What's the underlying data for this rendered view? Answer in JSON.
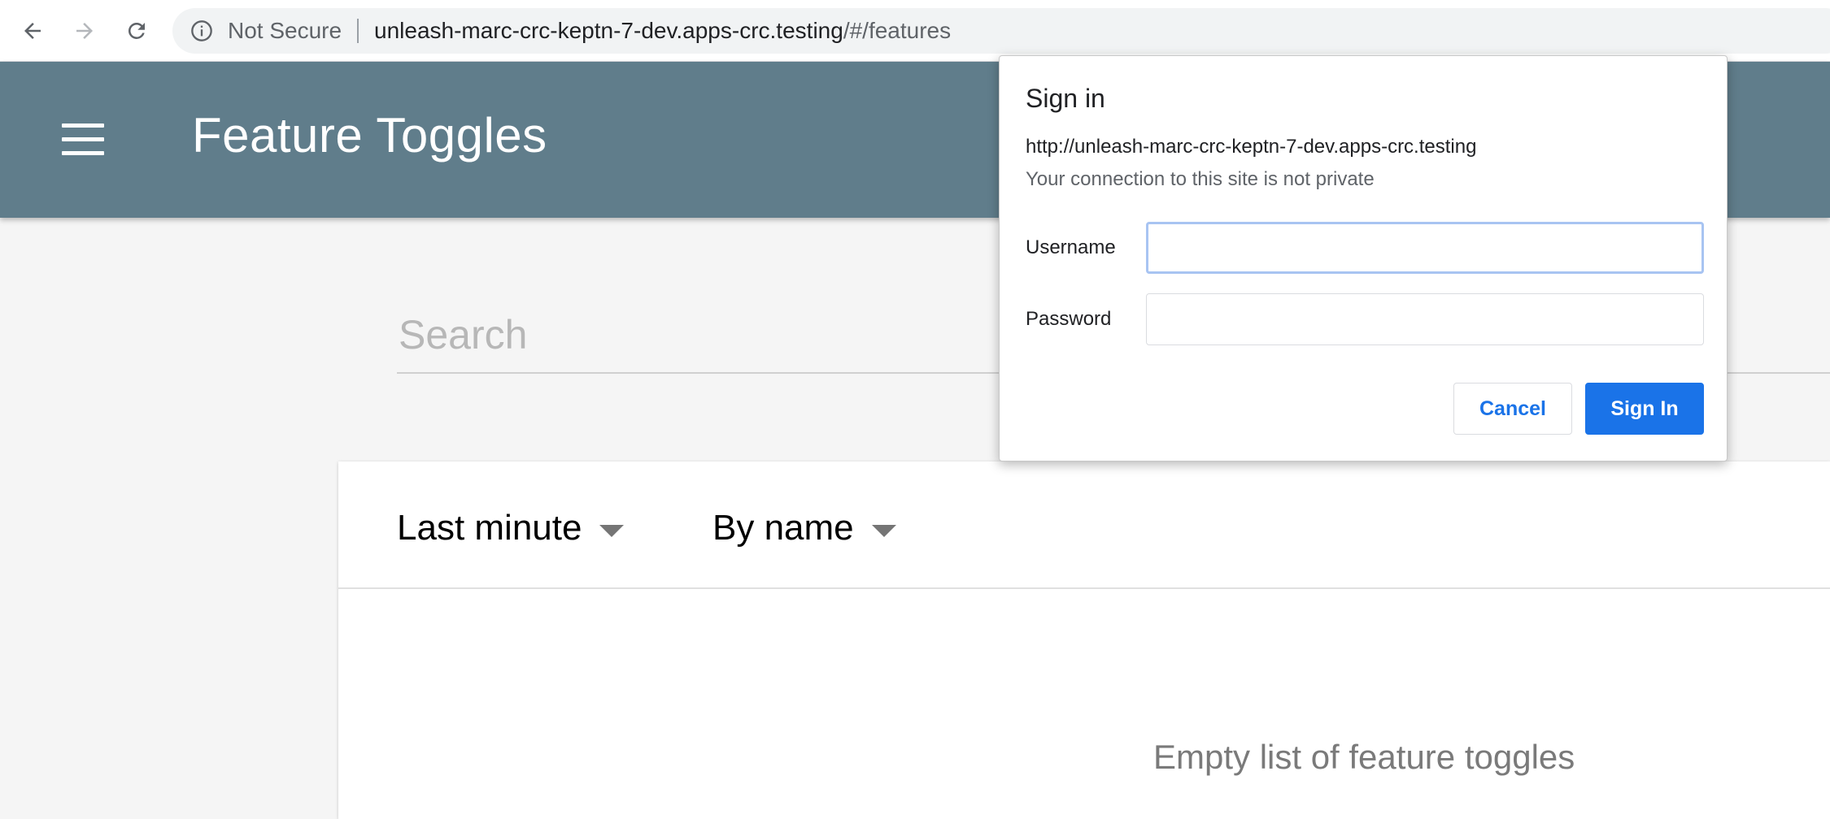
{
  "browser": {
    "security_label": "Not Secure",
    "url_host": "unleash-marc-crc-keptn-7-dev.apps-crc.testing",
    "url_path": "/#/features",
    "icons": {
      "back": "arrow-left-icon",
      "forward": "arrow-right-icon",
      "reload": "reload-icon",
      "info": "info-circle-icon"
    }
  },
  "header": {
    "title": "Feature Toggles",
    "menu_icon": "hamburger-menu-icon",
    "background_color": "#607d8b"
  },
  "search": {
    "placeholder": "Search",
    "value": ""
  },
  "toolbar": {
    "time_filter": "Last minute",
    "sort": "By name"
  },
  "list": {
    "empty_message": "Empty list of feature toggles"
  },
  "dialog": {
    "title": "Sign in",
    "url": "http://unleash-marc-crc-keptn-7-dev.apps-crc.testing",
    "warning": "Your connection to this site is not private",
    "username_label": "Username",
    "password_label": "Password",
    "username_value": "",
    "password_value": "",
    "cancel_label": "Cancel",
    "signin_label": "Sign In",
    "accent_color": "#1a73e8"
  }
}
